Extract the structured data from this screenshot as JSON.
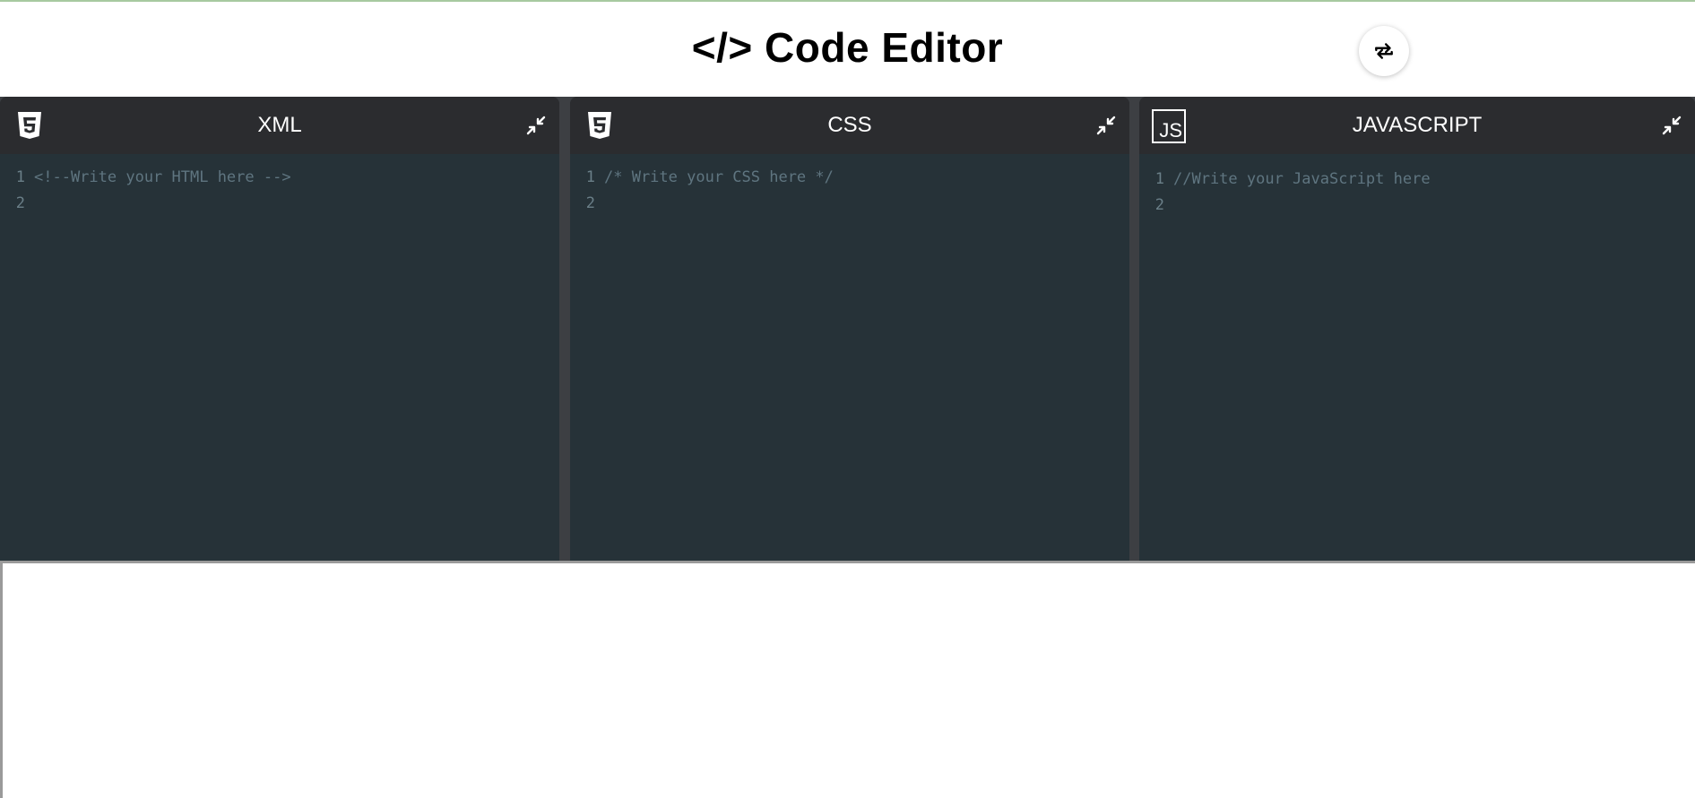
{
  "header": {
    "title": "</> Code Editor",
    "swap_icon": "swap-arrows-icon"
  },
  "editors": [
    {
      "title": "XML",
      "icon": "html5-icon",
      "lines": [
        {
          "num": "1",
          "text": "<!--Write your HTML here -->"
        },
        {
          "num": "2",
          "text": ""
        }
      ]
    },
    {
      "title": "CSS",
      "icon": "css3-icon",
      "lines": [
        {
          "num": "1",
          "text": "/* Write your CSS here */"
        },
        {
          "num": "2",
          "text": ""
        }
      ]
    },
    {
      "title": "JAVASCRIPT",
      "icon": "js-icon",
      "icon_text": "JS",
      "lines": [
        {
          "num": "1",
          "text": "//Write your JavaScript here"
        },
        {
          "num": "2",
          "text": ""
        }
      ]
    }
  ],
  "colors": {
    "panel_bg": "#263238",
    "header_bg": "#2b2c2f",
    "gutter": "#3d3f43"
  }
}
